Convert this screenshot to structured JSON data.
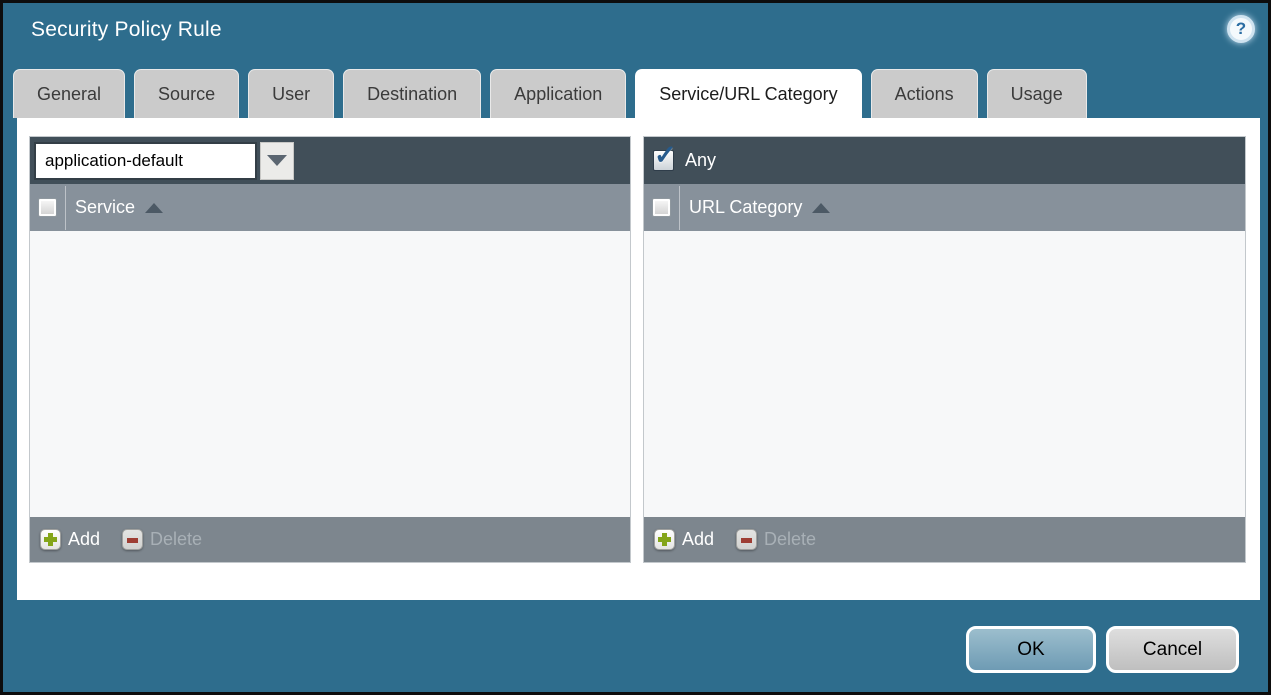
{
  "window": {
    "title": "Security Policy Rule"
  },
  "tabs": [
    {
      "label": "General",
      "active": false
    },
    {
      "label": "Source",
      "active": false
    },
    {
      "label": "User",
      "active": false
    },
    {
      "label": "Destination",
      "active": false
    },
    {
      "label": "Application",
      "active": false
    },
    {
      "label": "Service/URL Category",
      "active": true
    },
    {
      "label": "Actions",
      "active": false
    },
    {
      "label": "Usage",
      "active": false
    }
  ],
  "service_panel": {
    "dropdown_value": "application-default",
    "column_header": "Service",
    "sort_direction": "ascending",
    "add_label": "Add",
    "delete_label": "Delete",
    "delete_enabled": false,
    "rows": []
  },
  "url_category_panel": {
    "any_label": "Any",
    "any_checked": true,
    "column_header": "URL Category",
    "sort_direction": "ascending",
    "add_label": "Add",
    "delete_label": "Delete",
    "delete_enabled": false,
    "rows": []
  },
  "footer": {
    "ok_label": "OK",
    "cancel_label": "Cancel"
  },
  "icons": {
    "help": "?",
    "any_checkmark": "✓"
  },
  "colors": {
    "dialog_teal": "#2e6d8d",
    "panel_dark_bar": "#414f59",
    "panel_header_gray": "#87919b",
    "panel_footer_gray": "#7d868e",
    "active_tab": "#ffffff",
    "inactive_tab": "#cbcbcb",
    "add_green": "#84a51a",
    "delete_red": "#9e3d33",
    "ok_button_blue": "#7fa6bc",
    "cancel_button_gray": "#cecece",
    "checkmark_blue": "#255a8c"
  }
}
